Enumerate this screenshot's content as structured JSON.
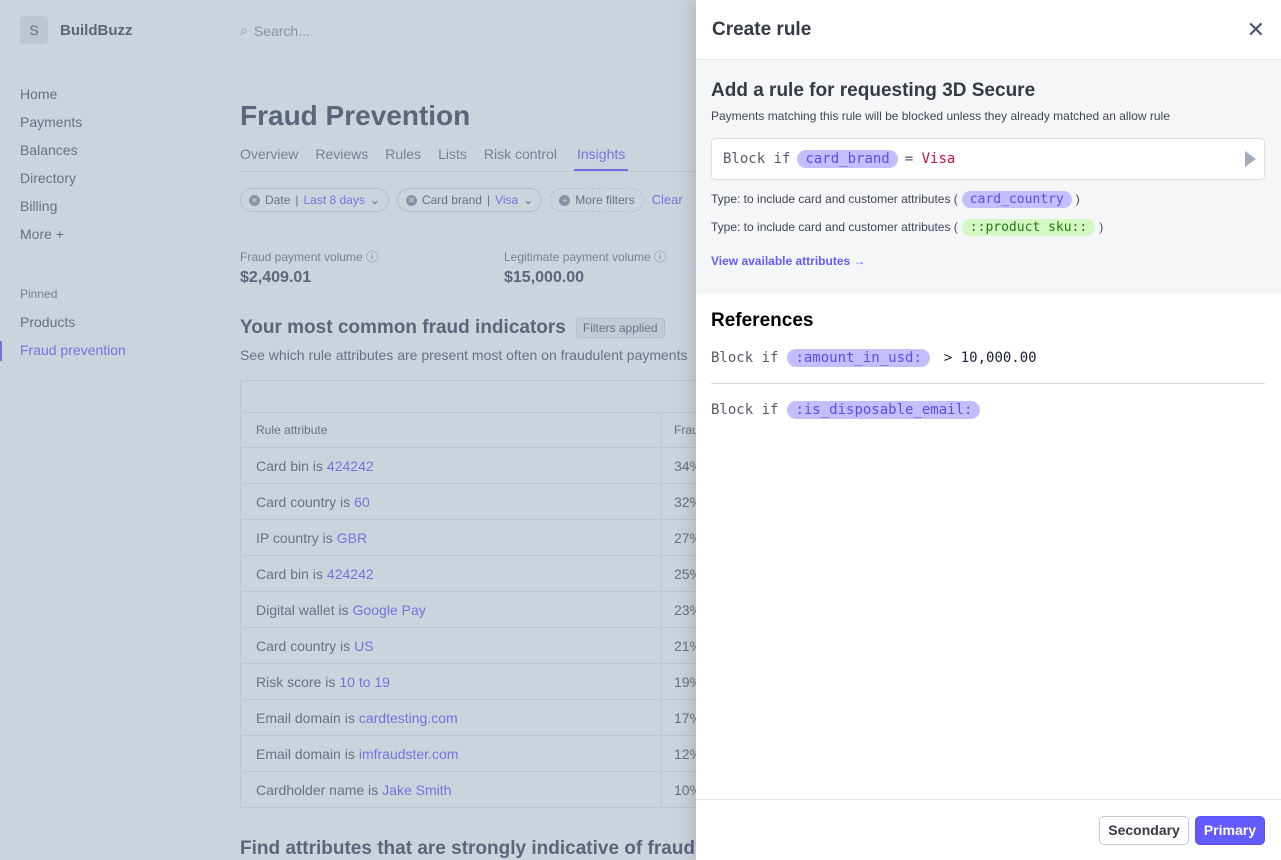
{
  "app": {
    "logo_letter": "S",
    "name": "BuildBuzz",
    "search_placeholder": "Search..."
  },
  "sidebar": {
    "items": [
      "Home",
      "Payments",
      "Balances",
      "Directory",
      "Billing",
      "More +"
    ],
    "pinned_label": "Pinned",
    "pinned": [
      "Products",
      "Fraud prevention"
    ],
    "active": "Fraud prevention"
  },
  "main": {
    "title": "Fraud Prevention",
    "tabs": [
      "Overview",
      "Reviews",
      "Rules",
      "Lists",
      "Risk control",
      "Insights"
    ],
    "active_tab": "Insights",
    "filters": [
      {
        "label": "Date",
        "value": "Last 8 days"
      },
      {
        "label": "Card brand",
        "value": "Visa"
      }
    ],
    "more_filters": "More filters",
    "clear": "Clear",
    "metrics": [
      {
        "label": "Fraud payment volume",
        "value": "$2,409.01"
      },
      {
        "label": "Legitimate payment volume",
        "value": "$15,000.00"
      }
    ],
    "section_title": "Your most common fraud indicators",
    "section_badge": "Filters applied",
    "section_sub": "See which rule attributes are present most often on fraudulent payments",
    "table": {
      "headers": [
        "Rule attribute",
        "Fraud"
      ],
      "rows": [
        {
          "attr": "Card bin is",
          "value": "424242",
          "pct": "34%"
        },
        {
          "attr": "Card country is",
          "value": "60",
          "pct": "32%"
        },
        {
          "attr": "IP country is",
          "value": "GBR",
          "pct": "27%"
        },
        {
          "attr": "Card bin is",
          "value": "424242",
          "pct": "25%"
        },
        {
          "attr": "Digital wallet is",
          "value": "Google Pay",
          "pct": "23%"
        },
        {
          "attr": "Card country is",
          "value": "US",
          "pct": "21%"
        },
        {
          "attr": "Risk score is",
          "value": "10 to 19",
          "pct": "19%"
        },
        {
          "attr": "Email domain is",
          "value": "cardtesting.com",
          "pct": "17%"
        },
        {
          "attr": "Email domain is",
          "value": "imfraudster.com",
          "pct": "12%"
        },
        {
          "attr": "Cardholder name is",
          "value": "Jake Smith",
          "pct": "10%"
        }
      ]
    },
    "bottom_title": "Find attributes that are strongly indicative of fraud"
  },
  "panel": {
    "title": "Create rule",
    "heading": "Add a rule for requesting 3D Secure",
    "description": "Payments matching this rule will be blocked unless they already matched an allow rule",
    "editor": {
      "prefix": "Block if",
      "token": "card_brand",
      "op": "=",
      "value": "Visa"
    },
    "hints": [
      {
        "text": "Type: to include card and customer attributes (",
        "token": ")",
        "example": "card_country"
      },
      {
        "text": "Type: to include card and customer attributes (",
        "token": ")",
        "example": "::product sku::"
      }
    ],
    "link": "View available attributes →",
    "references_title": "References",
    "references": [
      {
        "prefix": "Block if",
        "token": ":amount_in_usd:",
        "rest": "> 10,000.00"
      },
      {
        "prefix": "Block if",
        "token": ":is_disposable_email:",
        "rest": ""
      }
    ],
    "secondary": "Secondary",
    "primary": "Primary"
  },
  "colors": {
    "accent": "#635bff",
    "token_bg": "#c4beff",
    "token_green_bg": "#d4f7c4",
    "value_red": "#c0123c"
  }
}
